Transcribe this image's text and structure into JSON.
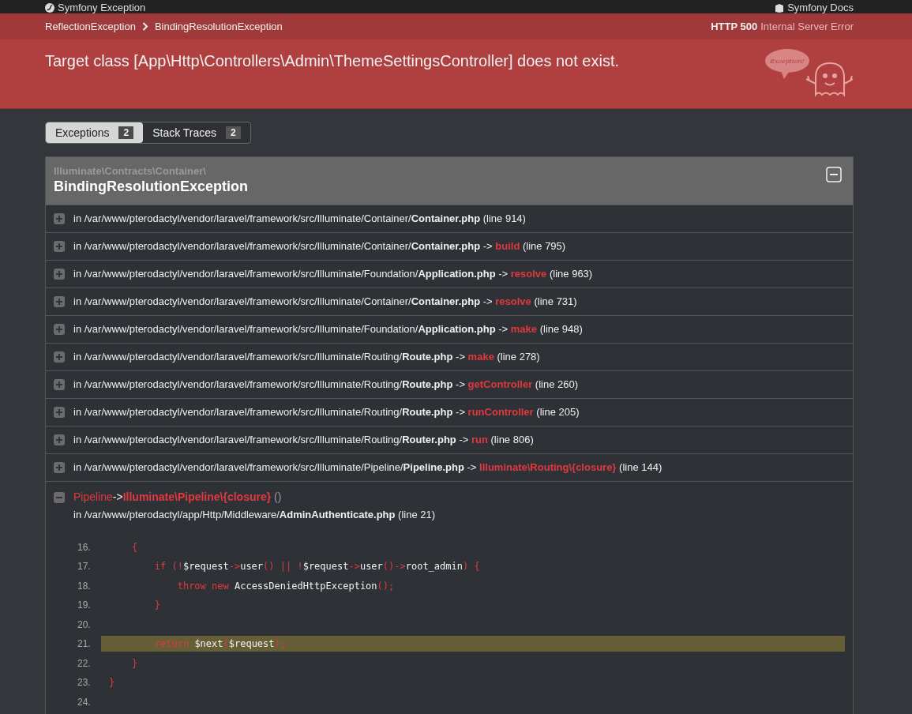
{
  "top_bar": {
    "title": "Symfony Exception",
    "docs_link": "Symfony Docs"
  },
  "breadcrumb": {
    "items": [
      "ReflectionException",
      "BindingResolutionException"
    ],
    "status_code": "HTTP 500",
    "status_text": "Internal Server Error"
  },
  "header": {
    "message": "Target class [App\\Http\\Controllers\\Admin\\ThemeSettingsController] does not exist.",
    "mascot_text": "Exception!"
  },
  "tabs": [
    {
      "label": "Exceptions",
      "count": "2",
      "selected": true
    },
    {
      "label": "Stack Traces",
      "count": "2",
      "selected": false
    }
  ],
  "exception": {
    "namespace": "Illuminate\\Contracts\\Container\\",
    "class": "BindingResolutionException",
    "expanded": true
  },
  "trace": [
    {
      "location": "in /var/www/pterodactyl/vendor/laravel/framework/src/Illuminate/Container/",
      "file": "Container.php",
      "line": "(line 914)",
      "expanded": false
    },
    {
      "location": "in /var/www/pterodactyl/vendor/laravel/framework/src/Illuminate/Container/",
      "file": "Container.php",
      "arrow": "->",
      "call": "build",
      "line": "(line 795)",
      "expanded": false
    },
    {
      "location": "in /var/www/pterodactyl/vendor/laravel/framework/src/Illuminate/Foundation/",
      "file": "Application.php",
      "arrow": "->",
      "call": "resolve",
      "line": "(line 963)",
      "expanded": false
    },
    {
      "location": "in /var/www/pterodactyl/vendor/laravel/framework/src/Illuminate/Container/",
      "file": "Container.php",
      "arrow": "->",
      "call": "resolve",
      "line": "(line 731)",
      "expanded": false
    },
    {
      "location": "in /var/www/pterodactyl/vendor/laravel/framework/src/Illuminate/Foundation/",
      "file": "Application.php",
      "arrow": "->",
      "call": "make",
      "line": "(line 948)",
      "expanded": false
    },
    {
      "location": "in /var/www/pterodactyl/vendor/laravel/framework/src/Illuminate/Routing/",
      "file": "Route.php",
      "arrow": "->",
      "call": "make",
      "line": "(line 278)",
      "expanded": false
    },
    {
      "location": "in /var/www/pterodactyl/vendor/laravel/framework/src/Illuminate/Routing/",
      "file": "Route.php",
      "arrow": "->",
      "call": "getController",
      "line": "(line 260)",
      "expanded": false
    },
    {
      "location": "in /var/www/pterodactyl/vendor/laravel/framework/src/Illuminate/Routing/",
      "file": "Route.php",
      "arrow": "->",
      "call": "runController",
      "line": "(line 205)",
      "expanded": false
    },
    {
      "location": "in /var/www/pterodactyl/vendor/laravel/framework/src/Illuminate/Routing/",
      "file": "Router.php",
      "arrow": "->",
      "call": "run",
      "line": "(line 806)",
      "expanded": false
    },
    {
      "location": "in /var/www/pterodactyl/vendor/laravel/framework/src/Illuminate/Pipeline/",
      "file": "Pipeline.php",
      "arrow": "->",
      "call": "Illuminate\\Routing\\{closure}",
      "line": "(line 144)",
      "expanded": false
    },
    {
      "class": "Pipeline",
      "arrow": "->",
      "call": "Illuminate\\Pipeline\\{closure}",
      "args": "()",
      "location": "in /var/www/pterodactyl/app/Http/Middleware/",
      "file": "AdminAuthenticate.php",
      "line": "(line 21)",
      "expanded": true,
      "code": [
        {
          "number": "16.",
          "highlighted": false,
          "tokens": [
            {
              "kind": "punct",
              "text": "    {"
            }
          ]
        },
        {
          "number": "17.",
          "highlighted": false,
          "tokens": [
            {
              "kind": "keyword",
              "text": "        if (!"
            },
            {
              "kind": "plain",
              "text": "$request"
            },
            {
              "kind": "punct",
              "text": "->"
            },
            {
              "kind": "plain",
              "text": "user"
            },
            {
              "kind": "punct",
              "text": "() || !"
            },
            {
              "kind": "plain",
              "text": "$request"
            },
            {
              "kind": "punct",
              "text": "->"
            },
            {
              "kind": "plain",
              "text": "user"
            },
            {
              "kind": "punct",
              "text": "()->"
            },
            {
              "kind": "plain",
              "text": "root_admin"
            },
            {
              "kind": "punct",
              "text": ") {"
            }
          ]
        },
        {
          "number": "18.",
          "highlighted": false,
          "tokens": [
            {
              "kind": "keyword",
              "text": "            throw new "
            },
            {
              "kind": "plain",
              "text": "AccessDeniedHttpException"
            },
            {
              "kind": "punct",
              "text": "();"
            }
          ]
        },
        {
          "number": "19.",
          "highlighted": false,
          "tokens": [
            {
              "kind": "punct",
              "text": "        }"
            }
          ]
        },
        {
          "number": "20.",
          "highlighted": false
        },
        {
          "number": "21.",
          "highlighted": true,
          "tokens": [
            {
              "kind": "keyword",
              "text": "        return "
            },
            {
              "kind": "plain",
              "text": "$next"
            },
            {
              "kind": "punct",
              "text": "("
            },
            {
              "kind": "plain",
              "text": "$request"
            },
            {
              "kind": "punct",
              "text": ");"
            }
          ]
        },
        {
          "number": "22.",
          "highlighted": false,
          "tokens": [
            {
              "kind": "punct",
              "text": "    }"
            }
          ]
        },
        {
          "number": "23.",
          "highlighted": false,
          "tokens": [
            {
              "kind": "punct",
              "text": "}"
            }
          ]
        },
        {
          "number": "24.",
          "highlighted": false
        }
      ]
    }
  ]
}
